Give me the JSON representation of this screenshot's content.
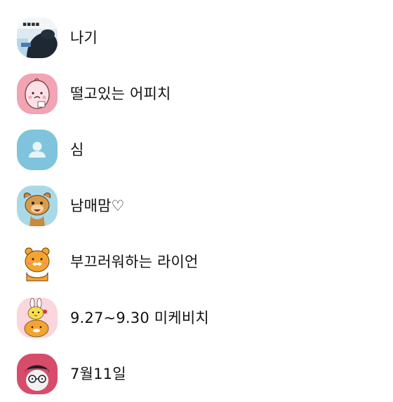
{
  "friends": [
    {
      "name": "",
      "avatar": "partial-top-avatar",
      "color": "#bfe3ee"
    },
    {
      "name": "나기",
      "avatar": "photo-avatar",
      "color": "#1d2833"
    },
    {
      "name": "떨고있는 어피치",
      "avatar": "apeach-avatar",
      "color": "#f2a3b4"
    },
    {
      "name": "심",
      "avatar": "default-person-avatar",
      "color": "#7fc4dc"
    },
    {
      "name": "남매맘♡",
      "avatar": "frodo-dog-avatar",
      "color": "#a9d9e6"
    },
    {
      "name": "부끄러워하는 라이언",
      "avatar": "ryan-avatar",
      "color": "#f4a531"
    },
    {
      "name": "9.27~9.30 미케비치",
      "avatar": "muzi-con-avatar",
      "color": "#f9d7dc"
    },
    {
      "name": "7월11일",
      "avatar": "neo-avatar",
      "color": "#d64c6a"
    }
  ]
}
